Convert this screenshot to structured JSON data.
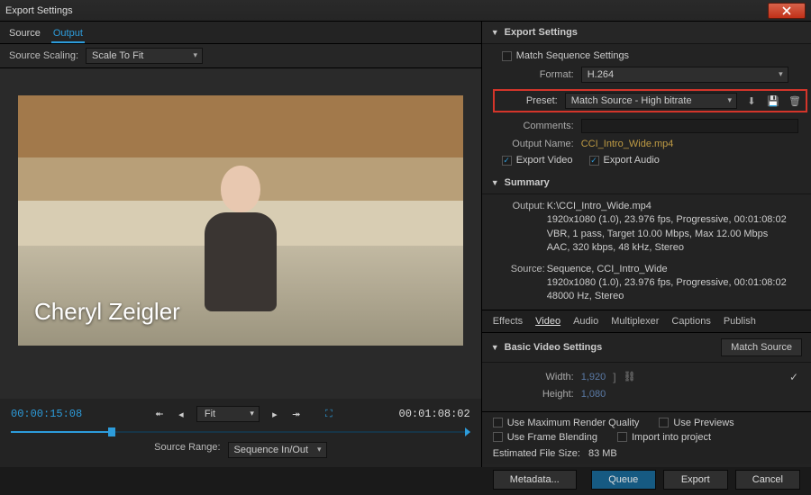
{
  "window": {
    "title": "Export Settings"
  },
  "left": {
    "tabs": {
      "source": "Source",
      "output": "Output"
    },
    "source_scaling_label": "Source Scaling:",
    "source_scaling_value": "Scale To Fit",
    "lower_third": "Cheryl Zeigler",
    "tc_in": "00:00:15:08",
    "tc_out": "00:01:08:02",
    "fit_label": "Fit",
    "source_range_label": "Source Range:",
    "source_range_value": "Sequence In/Out"
  },
  "export": {
    "heading": "Export Settings",
    "match_seq": "Match Sequence Settings",
    "format_label": "Format:",
    "format_value": "H.264",
    "preset_label": "Preset:",
    "preset_value": "Match Source - High bitrate",
    "comments_label": "Comments:",
    "output_name_label": "Output Name:",
    "output_name_value": "CCI_Intro_Wide.mp4",
    "export_video": "Export Video",
    "export_audio": "Export Audio"
  },
  "summary": {
    "heading": "Summary",
    "output_label": "Output:",
    "output_line1": "K:\\CCI_Intro_Wide.mp4",
    "output_line2": "1920x1080 (1.0), 23.976 fps, Progressive, 00:01:08:02",
    "output_line3": "VBR, 1 pass, Target 10.00 Mbps, Max 12.00 Mbps",
    "output_line4": "AAC, 320 kbps, 48 kHz, Stereo",
    "source_label": "Source:",
    "source_line1": "Sequence, CCI_Intro_Wide",
    "source_line2": "1920x1080 (1.0), 23.976 fps, Progressive, 00:01:08:02",
    "source_line3": "48000 Hz, Stereo"
  },
  "rtabs": {
    "effects": "Effects",
    "video": "Video",
    "audio": "Audio",
    "multiplexer": "Multiplexer",
    "captions": "Captions",
    "publish": "Publish"
  },
  "bvs": {
    "heading": "Basic Video Settings",
    "match_source_btn": "Match Source",
    "width_label": "Width:",
    "width_value": "1,920",
    "height_label": "Height:",
    "height_value": "1,080"
  },
  "bottom": {
    "max_render": "Use Maximum Render Quality",
    "use_previews": "Use Previews",
    "frame_blend": "Use Frame Blending",
    "import_project": "Import into project",
    "est_size_label": "Estimated File Size:",
    "est_size_value": "83 MB"
  },
  "buttons": {
    "metadata": "Metadata...",
    "queue": "Queue",
    "export": "Export",
    "cancel": "Cancel"
  }
}
